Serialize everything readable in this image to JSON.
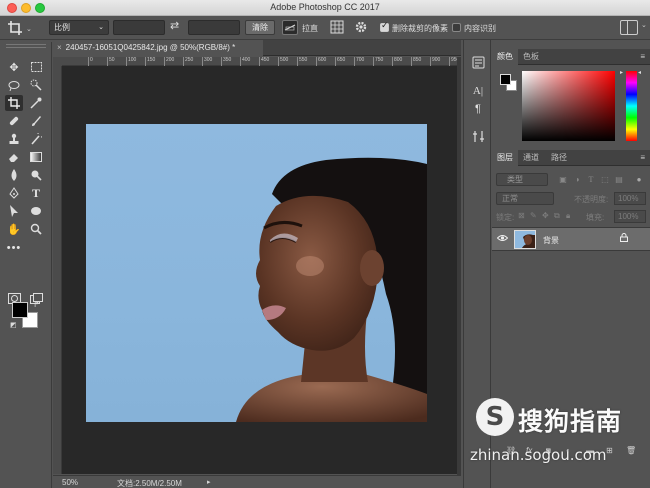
{
  "app": {
    "title": "Adobe Photoshop CC 2017"
  },
  "options_bar": {
    "ratio_label": "比例",
    "clear_label": "清除",
    "straighten_label": "拉直",
    "delete_cropped_label": "删除裁剪的像素",
    "delete_cropped_checked": true,
    "content_aware_label": "内容识别",
    "content_aware_checked": false
  },
  "document": {
    "tab_label": "240457-16051Q0425842.jpg @ 50%(RGB/8#) *",
    "close_glyph": "×",
    "ruler_ticks": [
      "0",
      "50",
      "100",
      "150",
      "200",
      "250",
      "300",
      "350",
      "400",
      "450",
      "500",
      "550",
      "600",
      "650",
      "700",
      "750",
      "800",
      "850",
      "900",
      "950",
      "1000"
    ]
  },
  "status_bar": {
    "zoom": "50%",
    "doc_size": "文档:2.50M/2.50M",
    "arrow": "▸"
  },
  "color_panel": {
    "tabs": [
      "颜色",
      "色板"
    ],
    "active_tab": 0,
    "menu_glyph": "≡"
  },
  "layers_panel": {
    "tabs": [
      "图层",
      "通道",
      "路径"
    ],
    "active_tab": 0,
    "menu_glyph": "≡",
    "filter_label": "类型",
    "blend_mode": "正常",
    "opacity_label": "不透明度:",
    "opacity_value": "100%",
    "lock_label": "锁定:",
    "fill_label": "填充:",
    "fill_value": "100%",
    "layer": {
      "name": "背景",
      "visible": true,
      "locked": true
    }
  },
  "watermark": {
    "logo_glyph": "S",
    "brand": "搜狗指南",
    "url": "zhinan.sogou.com"
  },
  "colors": {
    "canvas_bg": "#282828",
    "ui_bg": "#535353",
    "photo_bg": "#8fb9df"
  }
}
